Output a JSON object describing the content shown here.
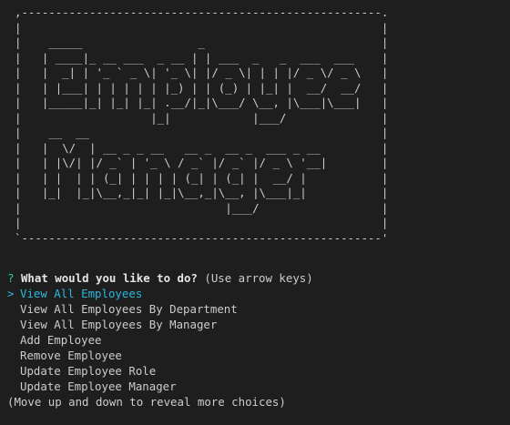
{
  "banner": {
    "art": ",-----------------------------------------------------.\n|                                                     |\n|    _____                 _                          |\n|   | ____|_ __ ___  _ __ | | ___  _   _  ___  ___    |\n|   |  _| | '_ ` _ \\| '_ \\| |/ _ \\| | | |/ _ \\/ _ \\   |\n|   | |___| | | | | | |_) | | (_) | |_| |  __/  __/   |\n|   |_____|_| |_| |_| .__/|_|\\___/ \\__, |\\___|\\___|   |\n|                   |_|            |___/              |\n|    __  __                                           |\n|   |  \\/  | __ _ _ __   __ _  __ _  ___ _ __         |\n|   | |\\/| |/ _` | '_ \\ / _` |/ _` |/ _ \\ '__|        |\n|   | |  | | (_| | | | | (_| | (_| |  __/ |           |\n|   |_|  |_|\\__,_|_| |_|\\__,_|\\__, |\\___|_|           |\n|                              |___/                  |\n|                                                     |\n`-----------------------------------------------------'"
  },
  "prompt": {
    "qmark": "?",
    "question": "What would you like to do?",
    "hint": "(Use arrow keys)"
  },
  "pointer": ">",
  "choices": [
    {
      "label": "View All Employees",
      "selected": true
    },
    {
      "label": "View All Employees By Department",
      "selected": false
    },
    {
      "label": "View All Employees By Manager",
      "selected": false
    },
    {
      "label": "Add Employee",
      "selected": false
    },
    {
      "label": "Remove Employee",
      "selected": false
    },
    {
      "label": "Update Employee Role",
      "selected": false
    },
    {
      "label": "Update Employee Manager",
      "selected": false
    }
  ],
  "footer": "(Move up and down to reveal more choices)",
  "colors": {
    "background": "#1e1e1e",
    "text": "#cccccc",
    "qmark": "#23d18b",
    "selected": "#29b8db"
  }
}
